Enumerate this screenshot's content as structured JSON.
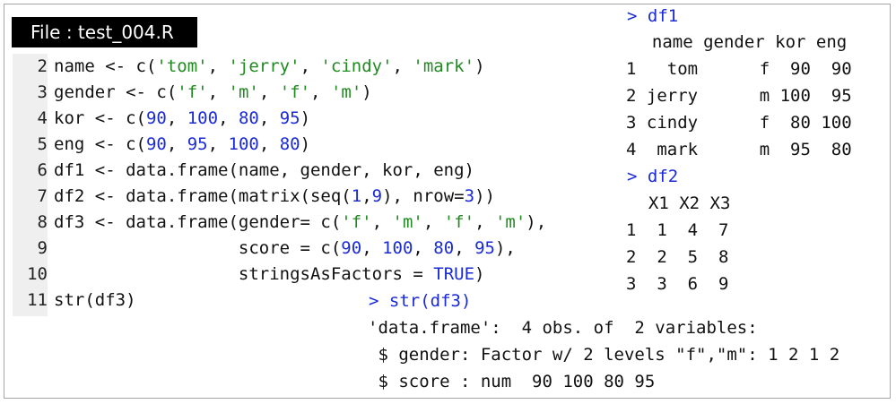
{
  "file_label": "File : test_004.R",
  "code": [
    {
      "num": "2",
      "parts": [
        [
          "name <- c(",
          "k"
        ],
        [
          "'tom'",
          "s"
        ],
        [
          ", ",
          "k"
        ],
        [
          "'jerry'",
          "s"
        ],
        [
          ", ",
          "k"
        ],
        [
          "'cindy'",
          "s"
        ],
        [
          ", ",
          "k"
        ],
        [
          "'mark'",
          "s"
        ],
        [
          ")",
          "k"
        ]
      ]
    },
    {
      "num": "3",
      "parts": [
        [
          "gender <- c(",
          "k"
        ],
        [
          "'f'",
          "s"
        ],
        [
          ", ",
          "k"
        ],
        [
          "'m'",
          "s"
        ],
        [
          ", ",
          "k"
        ],
        [
          "'f'",
          "s"
        ],
        [
          ", ",
          "k"
        ],
        [
          "'m'",
          "s"
        ],
        [
          ")",
          "k"
        ]
      ]
    },
    {
      "num": "4",
      "parts": [
        [
          "kor <- c(",
          "k"
        ],
        [
          "90",
          "n"
        ],
        [
          ", ",
          "k"
        ],
        [
          "100",
          "n"
        ],
        [
          ", ",
          "k"
        ],
        [
          "80",
          "n"
        ],
        [
          ", ",
          "k"
        ],
        [
          "95",
          "n"
        ],
        [
          ")",
          "k"
        ]
      ]
    },
    {
      "num": "5",
      "parts": [
        [
          "eng <- c(",
          "k"
        ],
        [
          "90",
          "n"
        ],
        [
          ", ",
          "k"
        ],
        [
          "95",
          "n"
        ],
        [
          ", ",
          "k"
        ],
        [
          "100",
          "n"
        ],
        [
          ", ",
          "k"
        ],
        [
          "80",
          "n"
        ],
        [
          ")",
          "k"
        ]
      ]
    },
    {
      "num": "6",
      "parts": [
        [
          "df1 <- data.frame(name, gender, kor, eng)",
          "k"
        ]
      ]
    },
    {
      "num": "7",
      "parts": [
        [
          "df2 <- data.frame(matrix(seq(",
          "k"
        ],
        [
          "1",
          "n"
        ],
        [
          ",",
          "k"
        ],
        [
          "9",
          "n"
        ],
        [
          "), nrow=",
          "k"
        ],
        [
          "3",
          "n"
        ],
        [
          "))",
          "k"
        ]
      ]
    },
    {
      "num": "8",
      "parts": [
        [
          "df3 <- data.frame(gender= c(",
          "k"
        ],
        [
          "'f'",
          "s"
        ],
        [
          ", ",
          "k"
        ],
        [
          "'m'",
          "s"
        ],
        [
          ", ",
          "k"
        ],
        [
          "'f'",
          "s"
        ],
        [
          ", ",
          "k"
        ],
        [
          "'m'",
          "s"
        ],
        [
          "),",
          "k"
        ]
      ]
    },
    {
      "num": "9",
      "parts": [
        [
          "                  score = c(",
          "k"
        ],
        [
          "90",
          "n"
        ],
        [
          ", ",
          "k"
        ],
        [
          "100",
          "n"
        ],
        [
          ", ",
          "k"
        ],
        [
          "80",
          "n"
        ],
        [
          ", ",
          "k"
        ],
        [
          "95",
          "n"
        ],
        [
          "),",
          "k"
        ]
      ]
    },
    {
      "num": "10",
      "parts": [
        [
          "                  stringsAsFactors = ",
          "k"
        ],
        [
          "TRUE",
          "t"
        ],
        [
          ")",
          "k"
        ]
      ]
    },
    {
      "num": "11",
      "parts": [
        [
          "str(df3)",
          "k"
        ]
      ]
    }
  ],
  "df1_output": {
    "prompt": "> df1",
    "header": "  name gender kor eng",
    "rows": [
      "1   tom      f  90  90",
      "2 jerry      m 100  95",
      "3 cindy      f  80 100",
      "4  mark      m  95  80"
    ]
  },
  "df2_output": {
    "prompt": "> df2",
    "header": "  X1 X2 X3",
    "rows": [
      "1  1  4  7",
      "2  2  5  8",
      "3  3  6  9"
    ]
  },
  "str_output": {
    "prompt": "> str(df3)",
    "lines": [
      "'data.frame':\t4 obs. of  2 variables:",
      " $ gender: Factor w/ 2 levels \"f\",\"m\": 1 2 1 2",
      " $ score : num  90 100 80 95"
    ]
  }
}
